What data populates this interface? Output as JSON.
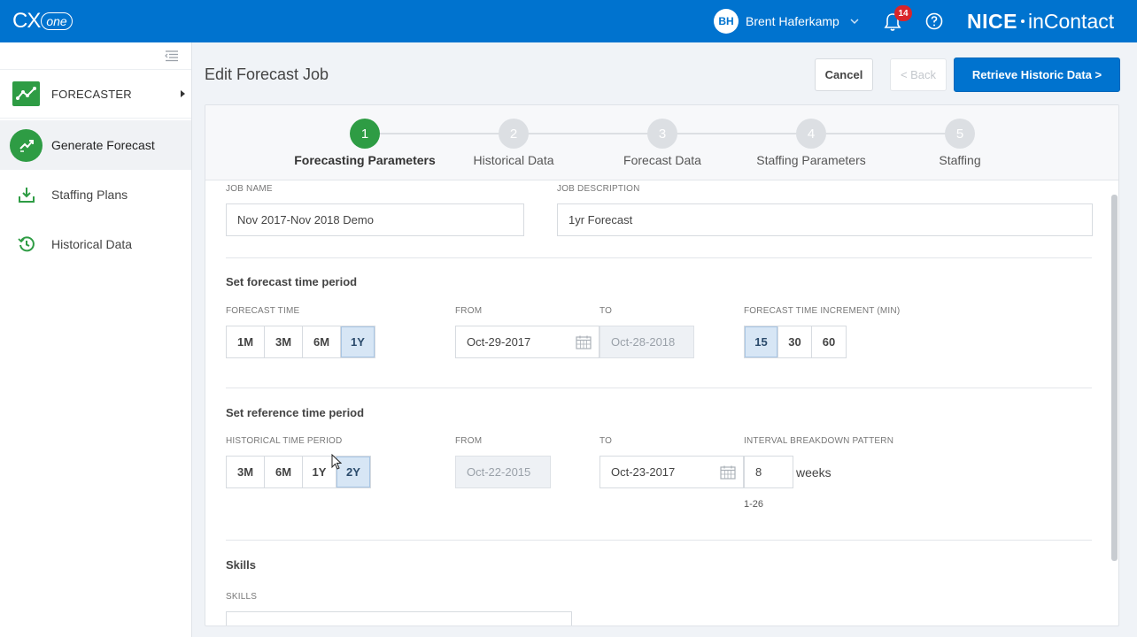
{
  "topbar": {
    "logo_cx": "CX",
    "logo_one": "one",
    "user_initials": "BH",
    "user_name": "Brent Haferkamp",
    "notification_count": "14",
    "brand_nice": "NICE",
    "brand_incontact": "inContact",
    "bg_color": "#0073cf"
  },
  "sidebar": {
    "header": "FORECASTER",
    "items": [
      {
        "label": "Generate Forecast",
        "icon": "generate-forecast-icon",
        "active": true
      },
      {
        "label": "Staffing Plans",
        "icon": "download-icon",
        "active": false
      },
      {
        "label": "Historical Data",
        "icon": "history-icon",
        "active": false
      }
    ]
  },
  "main": {
    "title": "Edit Forecast Job",
    "buttons": {
      "cancel": "Cancel",
      "back": "< Back",
      "retrieve": "Retrieve Historic Data >"
    }
  },
  "stepper": {
    "steps": [
      {
        "number": "1",
        "label": "Forecasting Parameters",
        "state": "current"
      },
      {
        "number": "2",
        "label": "Historical Data",
        "state": "pending"
      },
      {
        "number": "3",
        "label": "Forecast Data",
        "state": "pending"
      },
      {
        "number": "4",
        "label": "Staffing Parameters",
        "state": "pending"
      },
      {
        "number": "5",
        "label": "Staffing",
        "state": "pending"
      }
    ]
  },
  "form": {
    "job_name_label": "JOB NAME",
    "job_name_value": "Nov 2017-Nov 2018 Demo",
    "job_desc_label": "JOB DESCRIPTION",
    "job_desc_value": "1yr Forecast",
    "forecast_section": {
      "title": "Set forecast time period",
      "time_label": "FORECAST TIME",
      "time_options": [
        "1M",
        "3M",
        "6M",
        "1Y"
      ],
      "time_selected": "1Y",
      "from_label": "FROM",
      "from_value": "Oct-29-2017",
      "to_label": "TO",
      "to_value": "Oct-28-2018",
      "increment_label": "FORECAST TIME INCREMENT (MIN)",
      "increment_options": [
        "15",
        "30",
        "60"
      ],
      "increment_selected": "15"
    },
    "reference_section": {
      "title": "Set reference time period",
      "period_label": "HISTORICAL TIME PERIOD",
      "period_options": [
        "3M",
        "6M",
        "1Y",
        "2Y"
      ],
      "period_selected": "2Y",
      "from_label": "FROM",
      "from_value": "Oct-22-2015",
      "to_label": "TO",
      "to_value": "Oct-23-2017",
      "pattern_label": "INTERVAL BREAKDOWN PATTERN",
      "pattern_value": "8",
      "pattern_unit": "weeks",
      "pattern_hint": "1-26"
    },
    "skills_section": {
      "title": "Skills",
      "skills_label": "SKILLS"
    }
  }
}
